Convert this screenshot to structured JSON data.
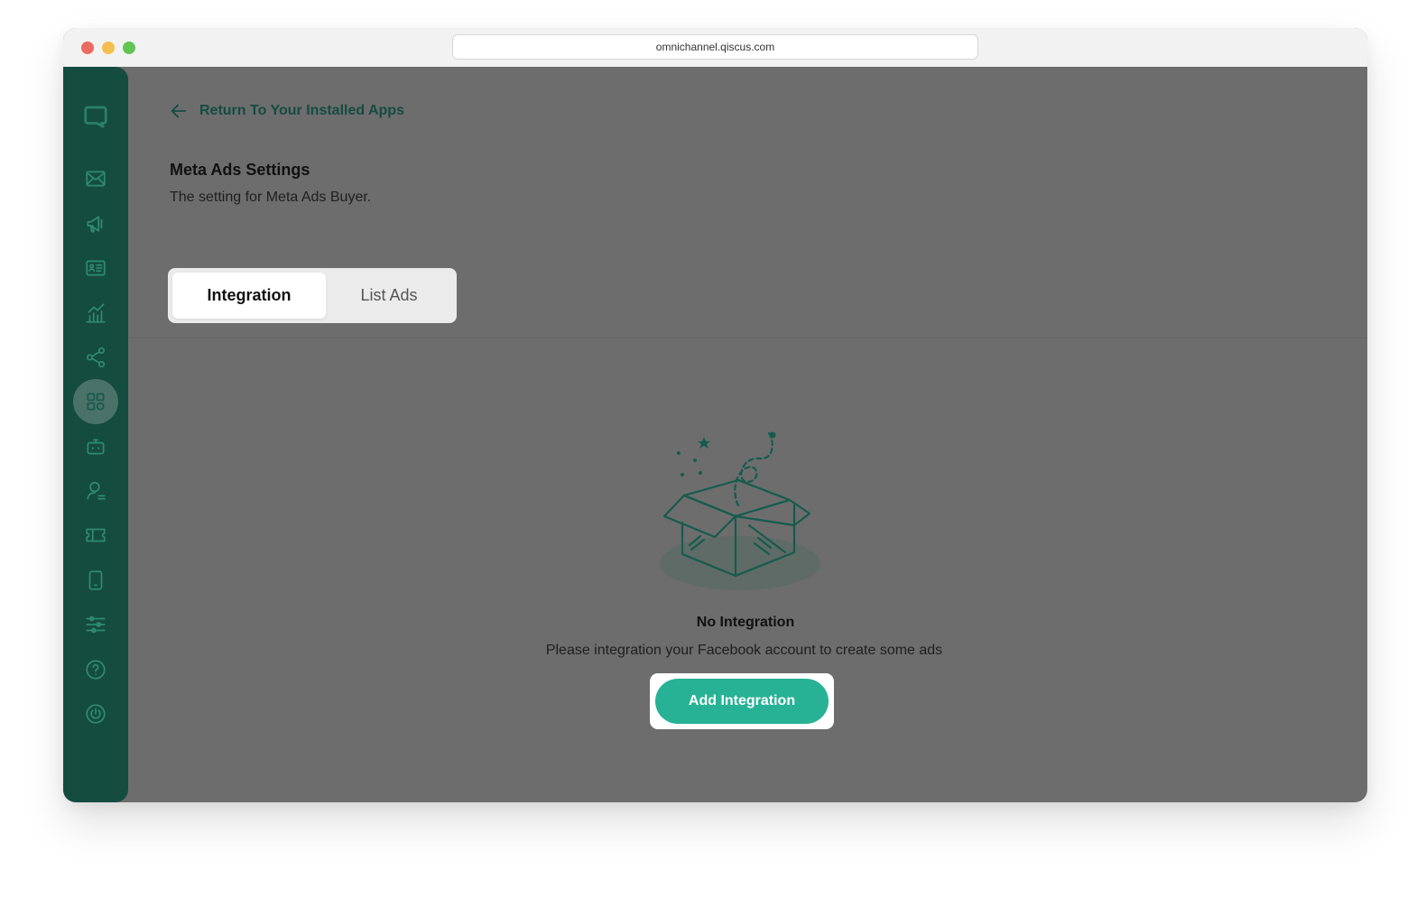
{
  "browser": {
    "url": "omnichannel.qiscus.com"
  },
  "sidebar": {
    "items": [
      {
        "name": "logo-icon"
      },
      {
        "name": "inbox-icon"
      },
      {
        "name": "megaphone-icon"
      },
      {
        "name": "contact-card-icon"
      },
      {
        "name": "analytics-icon"
      },
      {
        "name": "share-icon"
      },
      {
        "name": "apps-grid-icon",
        "active": true
      },
      {
        "name": "bot-icon"
      },
      {
        "name": "agent-icon"
      },
      {
        "name": "ticket-icon"
      },
      {
        "name": "mobile-icon"
      },
      {
        "name": "settings-sliders-icon"
      },
      {
        "name": "help-icon"
      },
      {
        "name": "power-icon"
      }
    ]
  },
  "header": {
    "back_label": "Return To Your Installed Apps",
    "title": "Meta Ads Settings",
    "subtitle": "The setting for Meta Ads Buyer."
  },
  "tabs": [
    {
      "label": "Integration",
      "active": true
    },
    {
      "label": "List Ads",
      "active": false
    }
  ],
  "empty_state": {
    "title": "No Integration",
    "description": "Please integration your Facebook account to create some ads",
    "button_label": "Add Integration"
  },
  "colors": {
    "sidebar": "#154c40",
    "accent": "#27b295",
    "overlay": "#6d6d6d"
  }
}
